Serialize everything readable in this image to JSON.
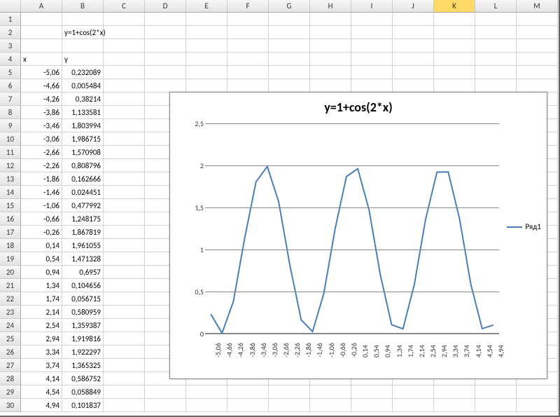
{
  "columns": [
    "A",
    "B",
    "C",
    "D",
    "E",
    "F",
    "G",
    "H",
    "I",
    "J",
    "K",
    "L",
    "M"
  ],
  "selected_col": "K",
  "formula_label": "y=1+cos(2*x)",
  "headers": {
    "x": "x",
    "y": "y"
  },
  "rows": [
    {
      "n": 1
    },
    {
      "n": 2,
      "b_txt": "y=1+cos(2*x)"
    },
    {
      "n": 3
    },
    {
      "n": 4,
      "a_txt": "x",
      "b_txt": "y"
    },
    {
      "n": 5,
      "a": "-5,06",
      "b": "0,232089"
    },
    {
      "n": 6,
      "a": "-4,66",
      "b": "0,005484"
    },
    {
      "n": 7,
      "a": "-4,26",
      "b": "0,38214"
    },
    {
      "n": 8,
      "a": "-3,86",
      "b": "1,133581"
    },
    {
      "n": 9,
      "a": "-3,46",
      "b": "1,803994"
    },
    {
      "n": 10,
      "a": "-3,06",
      "b": "1,986715"
    },
    {
      "n": 11,
      "a": "-2,66",
      "b": "1,570908"
    },
    {
      "n": 12,
      "a": "-2,26",
      "b": "0,808796"
    },
    {
      "n": 13,
      "a": "-1,86",
      "b": "0,162666"
    },
    {
      "n": 14,
      "a": "-1,46",
      "b": "0,024451"
    },
    {
      "n": 15,
      "a": "-1,06",
      "b": "0,477992"
    },
    {
      "n": 16,
      "a": "-0,66",
      "b": "1,248175"
    },
    {
      "n": 17,
      "a": "-0,26",
      "b": "1,867819"
    },
    {
      "n": 18,
      "a": "0,14",
      "b": "1,961055"
    },
    {
      "n": 19,
      "a": "0,54",
      "b": "1,471328"
    },
    {
      "n": 20,
      "a": "0,94",
      "b": "0,6957"
    },
    {
      "n": 21,
      "a": "1,34",
      "b": "0,104656"
    },
    {
      "n": 22,
      "a": "1,74",
      "b": "0,056715"
    },
    {
      "n": 23,
      "a": "2,14",
      "b": "0,580959"
    },
    {
      "n": 24,
      "a": "2,54",
      "b": "1,359387"
    },
    {
      "n": 25,
      "a": "2,94",
      "b": "1,919816"
    },
    {
      "n": 26,
      "a": "3,34",
      "b": "1,922297"
    },
    {
      "n": 27,
      "a": "3,74",
      "b": "1,365325"
    },
    {
      "n": 28,
      "a": "4,14",
      "b": "0,586752"
    },
    {
      "n": 29,
      "a": "4,54",
      "b": "0,058849"
    },
    {
      "n": 30,
      "a": "4,94",
      "b": "0,101837"
    }
  ],
  "chart_data": {
    "type": "line",
    "title": "y=1+cos(2*x)",
    "xlabel": "",
    "ylabel": "",
    "ylim": [
      0,
      2.5
    ],
    "yticks": [
      0,
      0.5,
      1,
      1.5,
      2,
      2.5
    ],
    "ytick_labels": [
      "0",
      "0,5",
      "1",
      "1,5",
      "2",
      "2,5"
    ],
    "legend": "Ряд1",
    "categories": [
      "-5,06",
      "-4,66",
      "-4,26",
      "-3,86",
      "-3,46",
      "-3,06",
      "-2,66",
      "-2,26",
      "-1,86",
      "-1,46",
      "-1,06",
      "-0,66",
      "-0,26",
      "0,14",
      "0,54",
      "0,94",
      "1,34",
      "1,74",
      "2,14",
      "2,54",
      "2,94",
      "3,34",
      "3,74",
      "4,14",
      "4,54",
      "4,94"
    ],
    "values": [
      0.232089,
      0.005484,
      0.38214,
      1.133581,
      1.803994,
      1.986715,
      1.570908,
      0.808796,
      0.162666,
      0.024451,
      0.477992,
      1.248175,
      1.867819,
      1.961055,
      1.471328,
      0.6957,
      0.104656,
      0.056715,
      0.580959,
      1.359387,
      1.919816,
      1.922297,
      1.365325,
      0.586752,
      0.058849,
      0.101837
    ]
  },
  "colors": {
    "line": "#4a7ebb"
  }
}
